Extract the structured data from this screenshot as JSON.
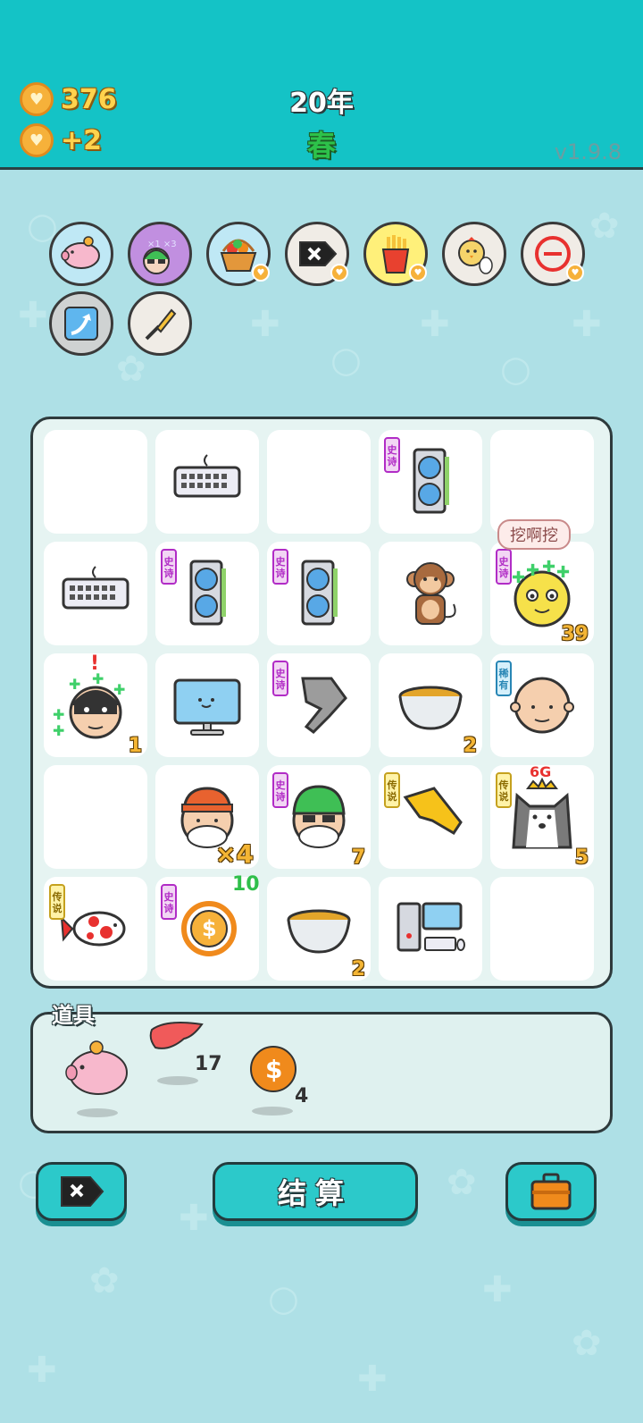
{
  "header": {
    "coins": "376",
    "income": "+2",
    "year": "20年",
    "season": "春",
    "version": "v1.9.8"
  },
  "relics": [
    {
      "name": "piggy-bank-relic-icon"
    },
    {
      "name": "multiplier-character-relic-icon"
    },
    {
      "name": "fruit-basket-relic-icon"
    },
    {
      "name": "delete-tag-relic-icon"
    },
    {
      "name": "french-fries-relic-icon"
    },
    {
      "name": "chick-egg-relic-icon"
    },
    {
      "name": "minus-circle-relic-icon"
    },
    {
      "name": "arrow-card-relic-icon"
    },
    {
      "name": "screwdriver-relic-icon"
    }
  ],
  "rarity_labels": {
    "epic": "史诗",
    "legend": "传说",
    "rare": "稀有"
  },
  "board": {
    "speech": "挖啊挖",
    "counts": {
      "yellow_face": "39",
      "thief": "1",
      "soup1": "2",
      "grandpa_red": "×4",
      "grandpa_green": "7",
      "husky": "5",
      "soup2": "2",
      "husky_top": "6G",
      "coin_bonus": "10"
    }
  },
  "tools": {
    "title": "道具",
    "liver_count": "17",
    "coin_count": "4"
  },
  "buttons": {
    "settle": "结算"
  },
  "colors": {
    "header": "#14c3c6",
    "background": "#aee0e6",
    "accent": "#2cc9ca",
    "count": "#f4b534"
  }
}
